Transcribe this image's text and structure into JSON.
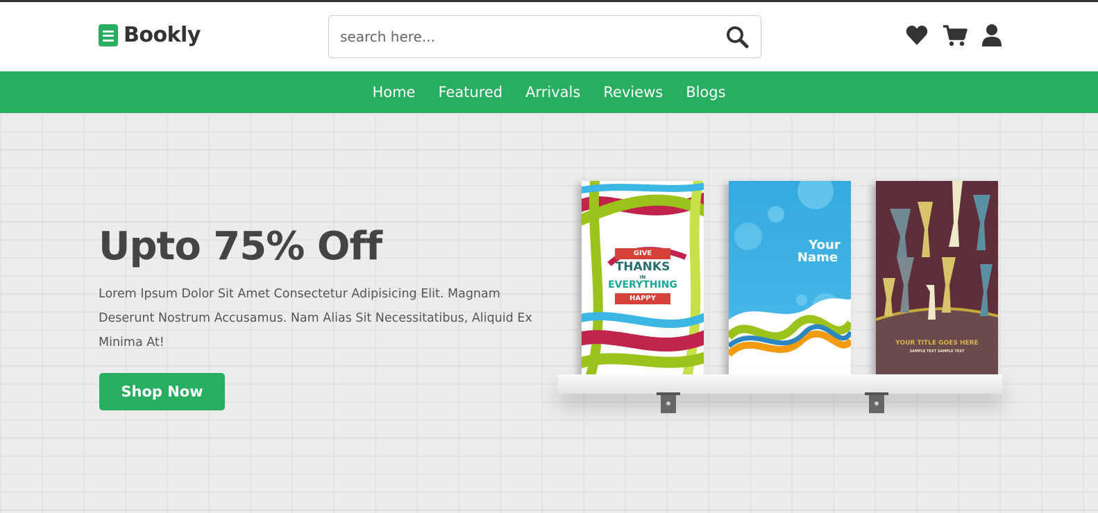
{
  "brand": {
    "name": "Bookly",
    "icon": "book-icon"
  },
  "search": {
    "placeholder": "search here...",
    "icon": "search-icon"
  },
  "header_icons": [
    "heart-icon",
    "cart-icon",
    "user-icon"
  ],
  "nav": {
    "items": [
      "Home",
      "Featured",
      "Arrivals",
      "Reviews",
      "Blogs"
    ]
  },
  "hero": {
    "title": "Upto 75% Off",
    "description": "Lorem Ipsum Dolor Sit Amet Consectetur Adipisicing Elit. Magnam Deserunt Nostrum Accusamus. Nam Alias Sit Necessitatibus, Aliquid Ex Minima At!",
    "cta": "Shop Now"
  },
  "books": [
    {
      "line1": "GIVE",
      "line2": "THANKS",
      "line3": "IN",
      "line4": "EVERYTHING",
      "line5": "HAPPY"
    },
    {
      "line1": "Your",
      "line2": "Name"
    },
    {
      "line1": "YOUR TITLE GOES HERE",
      "line2": "SAMPLE TEXT SAMPLE TEXT"
    }
  ],
  "colors": {
    "accent": "#27ae60",
    "text": "#444444"
  }
}
